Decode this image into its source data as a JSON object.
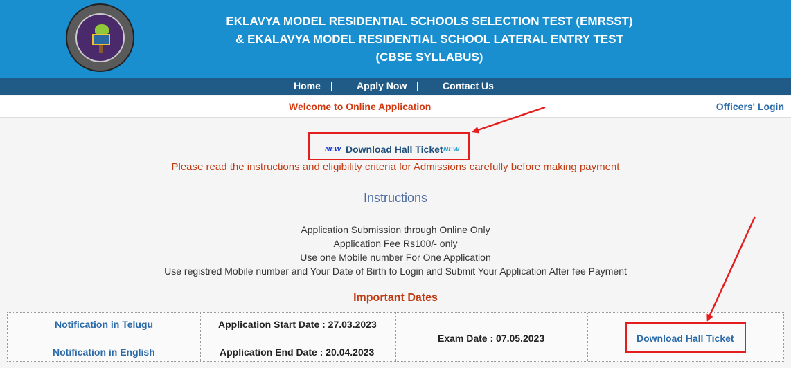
{
  "header": {
    "title_lines": [
      "EKLAVYA MODEL RESIDENTIAL SCHOOLS SELECTION TEST (EMRSST)",
      "& EKALAVYA MODEL RESIDENTIAL SCHOOL LATERAL ENTRY TEST",
      "(CBSE SYLLABUS)"
    ],
    "logo_icon": "emrs-logo-icon"
  },
  "nav": {
    "home": "Home",
    "apply": "Apply Now",
    "contact": "Contact Us",
    "separator": "|"
  },
  "welcome_bar": {
    "welcome": "Welcome to Online Application",
    "officers_login": "Officers' Login"
  },
  "main": {
    "new_badge": "NEW",
    "download_hall_ticket_top": "Download Hall Ticket",
    "please_read": "Please read the instructions and eligibility criteria for Admissions carefully before making payment",
    "instructions_heading": "Instructions",
    "instructions": [
      "Application Submission through Online Only",
      "Application Fee Rs100/- only",
      "Use one Mobile number For One Application",
      "Use registred Mobile number and Your Date of Birth to Login and Submit Your Application After fee Payment"
    ],
    "important_dates": "Important Dates"
  },
  "dates_table": {
    "notification_telugu": "Notification in Telugu",
    "notification_english": "Notification in English",
    "start_date": "Application Start Date : 27.03.2023",
    "end_date": "Application End Date : 20.04.2023",
    "exam_date": "Exam Date : 07.05.2023",
    "download_hall_ticket": "Download Hall Ticket"
  },
  "colors": {
    "header_bg": "#1a8fd0",
    "nav_bg": "#1f5b86",
    "accent_red": "#d23a12",
    "link_blue": "#2a6aa8",
    "highlight_box": "#e41e1e"
  }
}
